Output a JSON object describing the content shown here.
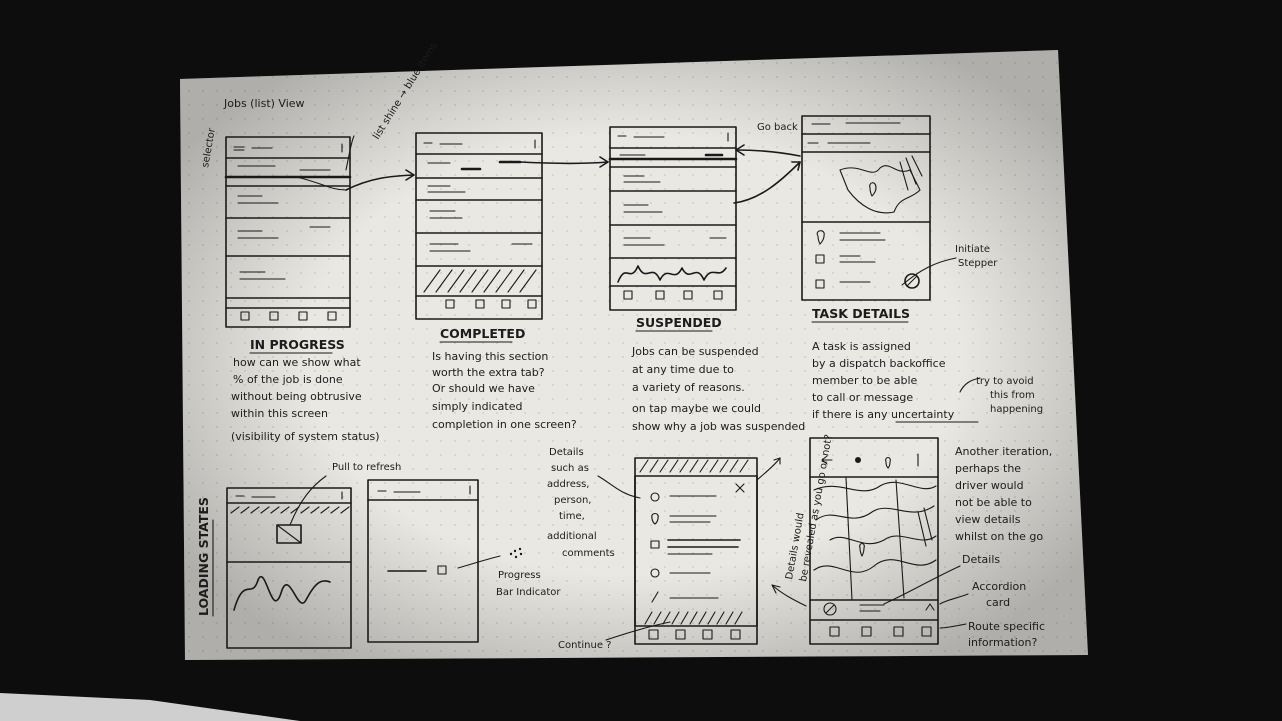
{
  "sheet_title": "Jobs (list) View",
  "side_labels": {
    "selector": "selector",
    "list_note": "list shine → blue items",
    "goback": "Go back",
    "loading_states": "LOADING STATES"
  },
  "sections": [
    {
      "title": "IN PROGRESS",
      "lines": [
        "how can we show what",
        "% of the job is done",
        "without being obtrusive",
        "within this screen",
        "(visibility of system status)"
      ]
    },
    {
      "title": "COMPLETED",
      "lines": [
        "Is having this section",
        "worth the extra tab?",
        "Or should we have",
        "simply indicated",
        "completion in one screen?"
      ]
    },
    {
      "title": "SUSPENDED",
      "lines": [
        "Jobs can be suspended",
        "at any time due to",
        "a variety of reasons.",
        "on tap maybe we could",
        "show why a job was suspended"
      ]
    },
    {
      "title": "TASK DETAILS",
      "lines": [
        "A task is assigned",
        "by a dispatch backoffice",
        "member to be able",
        "to call or message",
        "if there is any uncertainty"
      ]
    }
  ],
  "annotations": {
    "initiate_stepper": [
      "Initiate",
      "Stepper"
    ],
    "try_avoid": [
      "try to avoid",
      "this from",
      "happening"
    ],
    "pull_to_refresh": "Pull to refresh",
    "progress_bar": [
      "Progress",
      "Bar Indicator"
    ],
    "details_list": [
      "Details",
      "such as",
      "address,",
      "person,",
      "time,",
      "additional",
      "comments"
    ],
    "details_rotated": [
      "Details would",
      "be revealed as you go or not?"
    ],
    "continue": "Continue ?",
    "another_iteration": [
      "Another iteration,",
      "perhaps the",
      "driver would",
      "not be able to",
      "view details",
      "whilst on the go"
    ],
    "details_label": "Details",
    "accordion": [
      "Accordion",
      "card"
    ],
    "route_info": [
      "Route specific",
      "information?"
    ]
  },
  "colors": {
    "background": "#0d0d0d",
    "paper": "#e9e8e3",
    "ink": "#1a1a1a"
  }
}
